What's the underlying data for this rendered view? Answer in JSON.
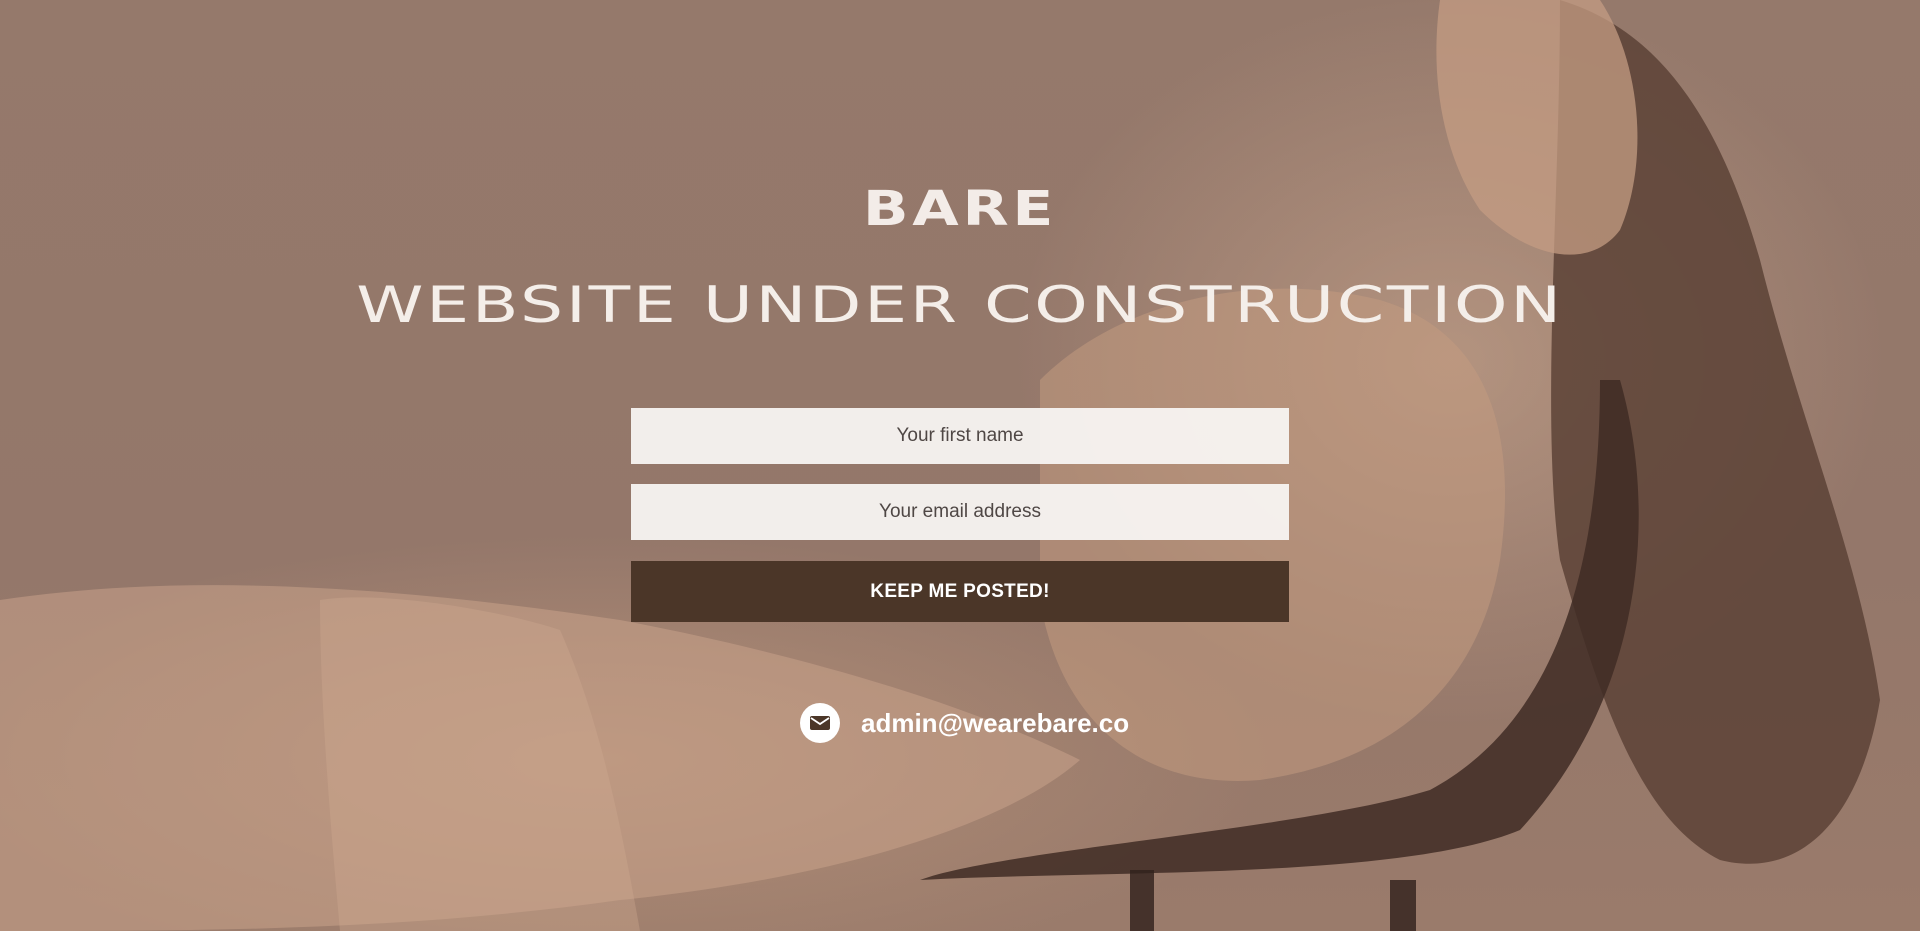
{
  "brand": {
    "logo_text": "BARE"
  },
  "hero": {
    "headline": "WEBSITE UNDER CONSTRUCTION"
  },
  "form": {
    "first_name_placeholder": "Your first name",
    "email_placeholder": "Your email address",
    "submit_label": "KEEP ME POSTED!"
  },
  "contact": {
    "icon": "envelope-icon",
    "email": "admin@wearebare.co"
  },
  "colors": {
    "background_overlay": "#94776a",
    "button": "#4b3628",
    "text_light": "#f4eee9",
    "input_background": "#f8f5f3"
  }
}
